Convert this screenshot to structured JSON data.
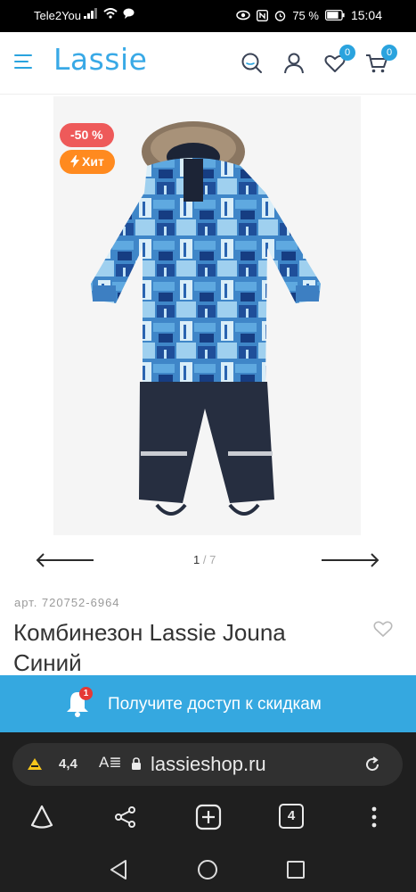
{
  "status_bar": {
    "carrier": "Tele2You",
    "battery": "75 %",
    "time": "15:04"
  },
  "header": {
    "logo": "Lassie",
    "wishlist_count": "0",
    "cart_count": "0",
    "icons": [
      "menu-icon",
      "search-icon",
      "user-icon",
      "heart-icon",
      "cart-icon"
    ]
  },
  "product": {
    "sale_badge": "-50 %",
    "hit_badge": "Хит",
    "pager": {
      "current": "1",
      "separator": "/",
      "total": "7"
    },
    "sku": "арт. 720752-6964",
    "title": "Комбинезон Lassie Jouna Синий"
  },
  "promo": {
    "text": "Получите доступ к скидкам",
    "notification_count": "1"
  },
  "browser": {
    "rating": "4,4",
    "url": "lassieshop.ru",
    "tabs_count": "4"
  },
  "colors": {
    "brand": "#39a9e6",
    "sale": "#ee5a5a",
    "hit": "#ff8a1f",
    "promo": "#35a8e0"
  }
}
